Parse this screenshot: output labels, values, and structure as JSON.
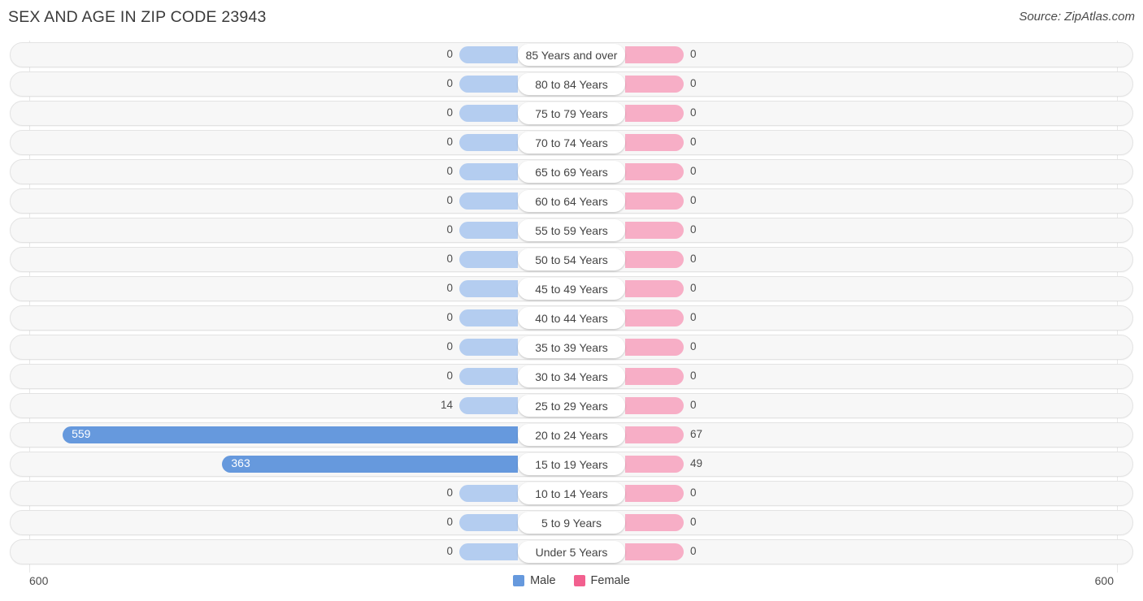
{
  "header": {
    "title": "SEX AND AGE IN ZIP CODE 23943",
    "source": "Source: ZipAtlas.com"
  },
  "footer": {
    "axis_left": "600",
    "axis_right": "600",
    "legend": [
      {
        "label": "Male",
        "color": "#6699dd",
        "icon": "square-swatch"
      },
      {
        "label": "Female",
        "color": "#f2608f",
        "icon": "square-swatch"
      }
    ]
  },
  "chart_data": {
    "type": "bar",
    "orientation": "horizontal",
    "style": "population-pyramid",
    "title": "SEX AND AGE IN ZIP CODE 23943",
    "xlabel": "",
    "ylabel": "",
    "xlim": [
      600,
      600
    ],
    "axis_max": 600,
    "grid": false,
    "legend_position": "bottom-center",
    "categories": [
      "85 Years and over",
      "80 to 84 Years",
      "75 to 79 Years",
      "70 to 74 Years",
      "65 to 69 Years",
      "60 to 64 Years",
      "55 to 59 Years",
      "50 to 54 Years",
      "45 to 49 Years",
      "40 to 44 Years",
      "35 to 39 Years",
      "30 to 34 Years",
      "25 to 29 Years",
      "20 to 24 Years",
      "15 to 19 Years",
      "10 to 14 Years",
      "5 to 9 Years",
      "Under 5 Years"
    ],
    "series": [
      {
        "name": "Male",
        "color": "#6699dd",
        "muted_color": "#b4cdf0",
        "values": [
          0,
          0,
          0,
          0,
          0,
          0,
          0,
          0,
          0,
          0,
          0,
          0,
          14,
          559,
          363,
          0,
          0,
          0
        ]
      },
      {
        "name": "Female",
        "color": "#f2608f",
        "muted_color": "#f7aec6",
        "values": [
          0,
          0,
          0,
          0,
          0,
          0,
          0,
          0,
          0,
          0,
          0,
          0,
          0,
          67,
          49,
          0,
          0,
          0
        ]
      }
    ],
    "male_labels": [
      "0",
      "0",
      "0",
      "0",
      "0",
      "0",
      "0",
      "0",
      "0",
      "0",
      "0",
      "0",
      "14",
      "559",
      "363",
      "0",
      "0",
      "0"
    ],
    "female_labels": [
      "0",
      "0",
      "0",
      "0",
      "0",
      "0",
      "0",
      "0",
      "0",
      "0",
      "0",
      "0",
      "0",
      "67",
      "49",
      "0",
      "0",
      "0"
    ]
  }
}
